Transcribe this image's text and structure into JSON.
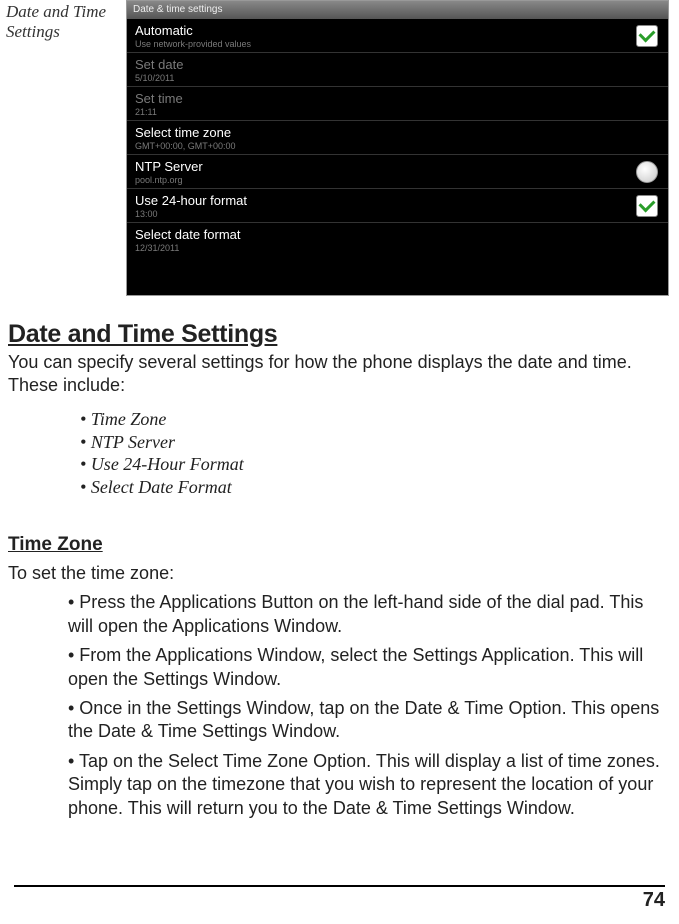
{
  "caption": "Date and Time Settings",
  "titlebar": "Date & time settings",
  "rows": [
    {
      "title": "Automatic",
      "sub": "Use network-provided values",
      "widget": "check",
      "dim": false
    },
    {
      "title": "Set date",
      "sub": "5/10/2011",
      "widget": "",
      "dim": true
    },
    {
      "title": "Set time",
      "sub": "21:11",
      "widget": "",
      "dim": true
    },
    {
      "title": "Select time zone",
      "sub": "GMT+00:00, GMT+00:00",
      "widget": "",
      "dim": false
    },
    {
      "title": "NTP Server",
      "sub": "pool.ntp.org",
      "widget": "radio",
      "dim": false
    },
    {
      "title": "Use 24-hour format",
      "sub": "13:00",
      "widget": "check",
      "dim": false
    },
    {
      "title": "Select date format",
      "sub": "12/31/2011",
      "widget": "",
      "dim": false
    }
  ],
  "heading": "Date and Time Settings",
  "intro": "You can specify several settings for how the phone displays the date and time. These include:",
  "bulletlist": [
    "Time Zone",
    "NTP Server",
    "Use 24-Hour Format",
    "Select Date Format"
  ],
  "subheading": "Time Zone",
  "toset": "To set the time zone:",
  "steps": [
    "• Press the Applications Button on the left-hand side of the dial pad. This will open the Applications Window.",
    "• From the Applications Window, select the Settings Application. This will open the Settings Window.",
    "• Once in the Settings Window, tap on the Date & Time Option. This opens the Date & Time Settings Window.",
    "• Tap on the Select Time Zone Option. This will display a list of time zones. Simply tap on the timezone that you wish to represent the location of your phone. This will return you to the Date & Time Settings Window."
  ],
  "pagenum": "74"
}
